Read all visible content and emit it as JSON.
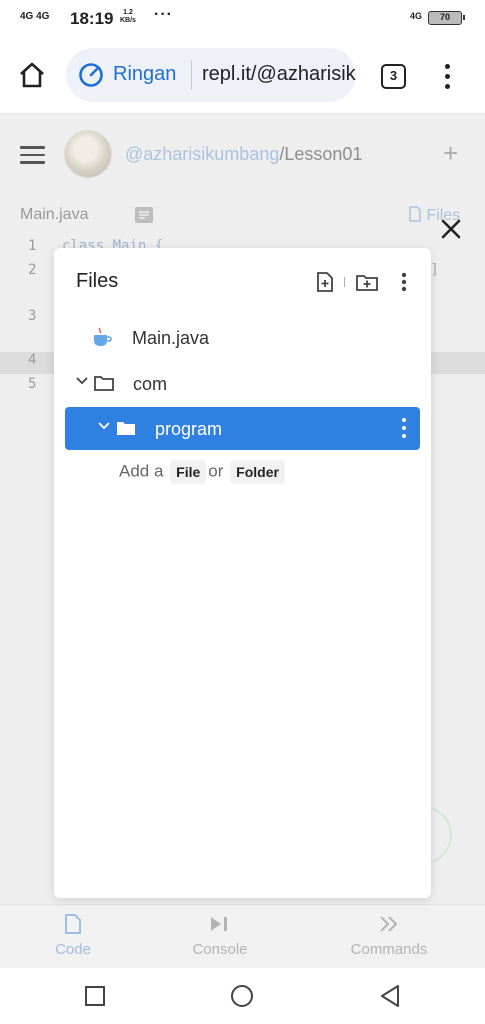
{
  "status_bar": {
    "network_left": "4G 4G",
    "time": "18:19",
    "speed_value": "1.2",
    "speed_unit": "KB/s",
    "more": "···",
    "network_right": "4G",
    "battery": "70"
  },
  "browser": {
    "home_icon": "home-icon",
    "brand": "Ringan",
    "url": "repl.it/@azharisikumbang",
    "tab_count": "3",
    "menu_icon": "more-vertical-icon"
  },
  "app": {
    "repo_user": "@azharisikumbang",
    "repo_rest": "/Lesson01",
    "add_label": "+",
    "file_tab": "Main.java",
    "files_link": "Files",
    "lines": [
      {
        "num": "1",
        "code": "class Main {"
      },
      {
        "num": "2",
        "code": ""
      },
      {
        "num": "3",
        "code": ""
      },
      {
        "num": "4",
        "code": ""
      },
      {
        "num": "5",
        "code": ""
      }
    ],
    "bracket": "[]",
    "nav": [
      {
        "label": "Code",
        "icon": "file-icon"
      },
      {
        "label": "Console",
        "icon": "console-icon"
      },
      {
        "label": "Commands",
        "icon": "chevrons-right-icon"
      }
    ]
  },
  "dialog": {
    "title": "Files",
    "tree": [
      {
        "label": "Main.java",
        "icon": "java-cup-icon",
        "level": 0
      },
      {
        "label": "com",
        "icon": "folder-icon",
        "level": 0,
        "expanded": true
      },
      {
        "label": "program",
        "icon": "folder-icon",
        "level": 1,
        "expanded": true,
        "selected": true
      }
    ],
    "add_prefix": "Add a",
    "add_file": "File",
    "add_or": "or",
    "add_folder": "Folder"
  },
  "colors": {
    "accent": "#2f80e0",
    "brand_blue": "#1f6fd6",
    "dim_background": "#eeeeee"
  }
}
